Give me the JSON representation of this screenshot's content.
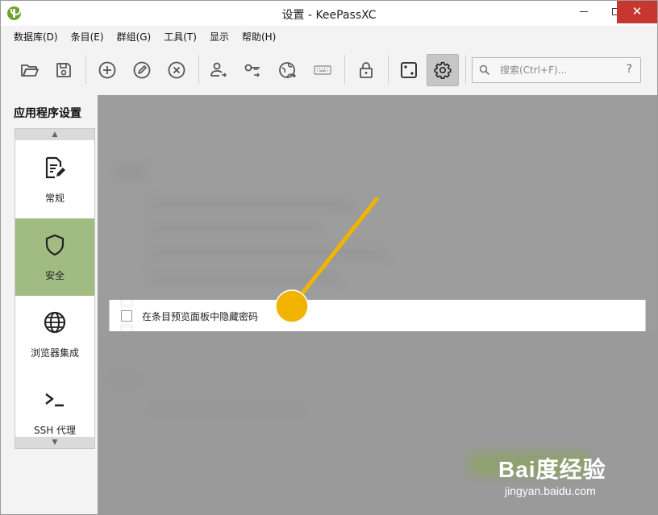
{
  "window": {
    "title": "设置 - KeePassXC",
    "close_glyph": "✕"
  },
  "menu": [
    {
      "label": "数据库(D)"
    },
    {
      "label": "条目(E)"
    },
    {
      "label": "群组(G)"
    },
    {
      "label": "工具(T)"
    },
    {
      "label": "显示"
    },
    {
      "label": "帮助(H)"
    }
  ],
  "toolbar": {
    "buttons": [
      {
        "name": "open-database-button",
        "icon": "folder-open-icon"
      },
      {
        "name": "save-database-button",
        "icon": "save-icon"
      },
      {
        "name": "add-entry-button",
        "icon": "plus-circle-icon"
      },
      {
        "name": "edit-entry-button",
        "icon": "pencil-circle-icon"
      },
      {
        "name": "delete-entry-button",
        "icon": "x-circle-icon"
      },
      {
        "name": "copy-username-button",
        "icon": "user-copy-icon"
      },
      {
        "name": "copy-password-button",
        "icon": "key-icon"
      },
      {
        "name": "open-url-button",
        "icon": "globe-icon"
      },
      {
        "name": "autotype-button",
        "icon": "keyboard-icon"
      },
      {
        "name": "lock-database-button",
        "icon": "lock-icon"
      },
      {
        "name": "password-generator-button",
        "icon": "dice-icon"
      },
      {
        "name": "settings-button",
        "icon": "gear-icon",
        "active": true
      }
    ],
    "search": {
      "placeholder": "搜索(Ctrl+F)...",
      "help_glyph": "?"
    }
  },
  "sidebar": {
    "title": "应用程序设置",
    "items": [
      {
        "label": "常规",
        "icon": "document-edit-icon"
      },
      {
        "label": "安全",
        "icon": "shield-icon",
        "selected": true
      },
      {
        "label": "浏览器集成",
        "icon": "globe-icon"
      },
      {
        "label": "SSH 代理",
        "icon": "terminal-icon"
      }
    ]
  },
  "content": {
    "visible_option": {
      "label": "在条目预览面板中隐藏密码",
      "checked": false
    }
  },
  "watermark": {
    "brand": "Bai度经验",
    "url": "jingyan.baidu.com"
  },
  "colors": {
    "selected_item": "#a1bc82",
    "close_button": "#c7372f",
    "pointer": "#f2b400",
    "overlay": "#9c9c9c"
  }
}
